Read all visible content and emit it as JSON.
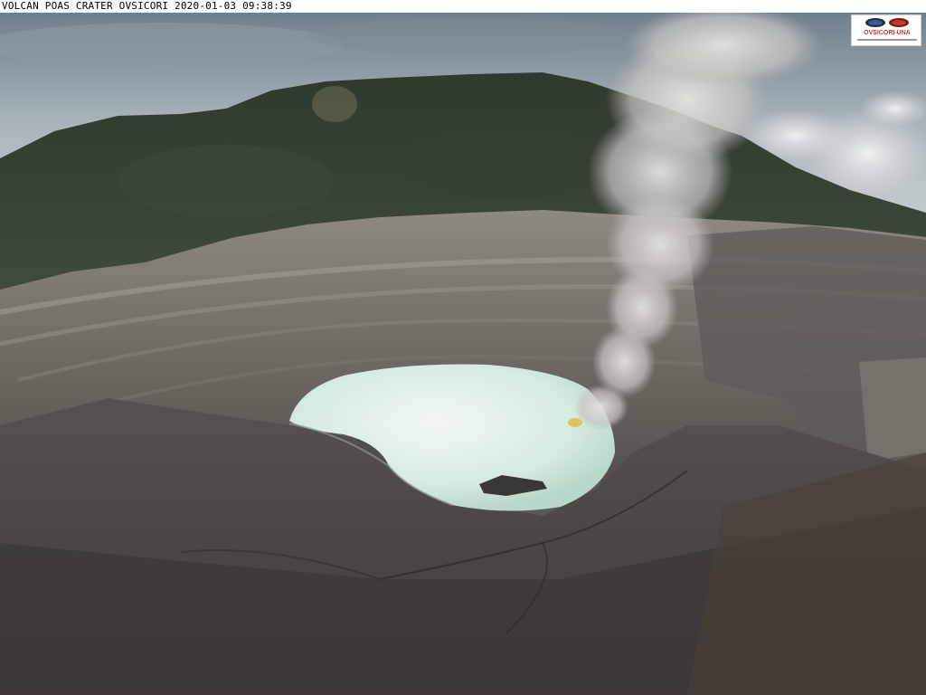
{
  "camera_caption": "VOLCAN POAS CRATER OVSICORI 2020-01-03 09:38:39",
  "logo": {
    "label": "OVSICORI-UNA",
    "subtitle": "Observatorio Vulcanológico y Sismológico de Costa Rica",
    "icon": "ovsicori-logo"
  },
  "colors": {
    "caption_background": "#ffffff",
    "caption_text": "#000000",
    "lake": "#d9ece0",
    "plume": "#c9c7c3",
    "vegetation": "#3a4537",
    "crater_rock": "#6d6a64",
    "logo_red": "#c0392b"
  }
}
